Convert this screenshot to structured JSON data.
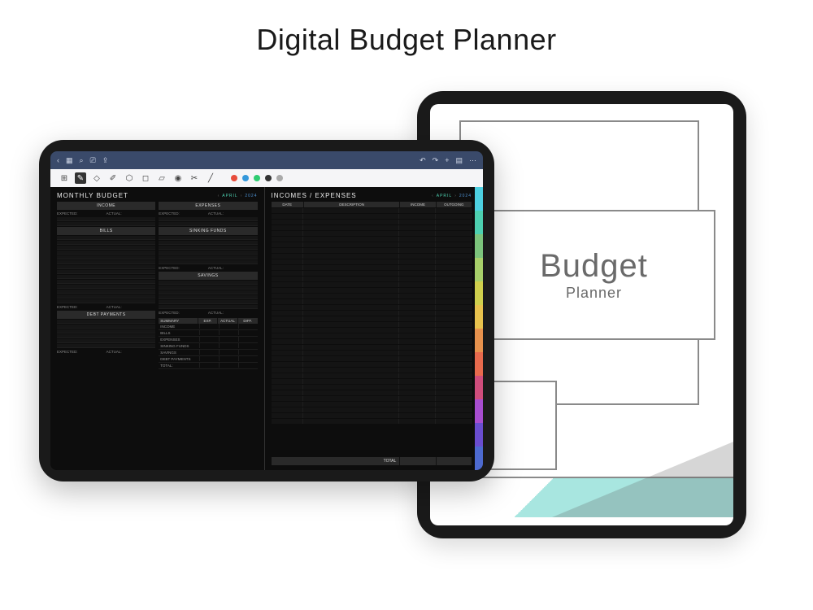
{
  "page_title": "Digital Budget Planner",
  "cover": {
    "title": "Budget",
    "subtitle": "Planner"
  },
  "titlebar": {
    "back": "‹",
    "grid": "▦",
    "search": "⌕",
    "bookmark": "⎚",
    "share": "⇪",
    "undo": "↶",
    "redo": "↷",
    "add": "+",
    "layers": "▤",
    "more": "⋯"
  },
  "toolbar_colors": [
    "red",
    "blue",
    "green",
    "black",
    "gray"
  ],
  "left": {
    "title": "MONTHLY BUDGET",
    "month": "APRIL",
    "year": "2024",
    "categories": {
      "income": "INCOME",
      "expenses": "EXPENSES",
      "bills": "BILLS",
      "sinking": "SINKING FUNDS",
      "savings": "SAVINGS",
      "debt": "DEBT PAYMENTS"
    },
    "labels": {
      "expected": "EXPECTED:",
      "actual": "ACTUAL:"
    },
    "summary": {
      "title": "SUMMARY",
      "cols": [
        "EXP.",
        "ACTUAL",
        "DIFF."
      ],
      "rows": [
        "INCOME",
        "BILLS",
        "EXPENSES",
        "SINKING FUNDS",
        "SAVINGS",
        "DEBT PAYMENTS",
        "TOTAL:"
      ]
    }
  },
  "right": {
    "title": "INCOMES / EXPENSES",
    "month": "APRIL",
    "year": "2024",
    "cols": {
      "date": "DATE",
      "desc": "DESCRIPTION",
      "income": "INCOME",
      "outgoing": "OUTGOING"
    },
    "total": "TOTAL"
  },
  "tabs": [
    "#4dd0e1",
    "#4dd0b0",
    "#7cc47c",
    "#a8d06a",
    "#d0d04d",
    "#e8c24d",
    "#e8924d",
    "#e86a4d",
    "#d04d7c",
    "#a84dd0",
    "#6a4dd0",
    "#4d6ad0"
  ]
}
